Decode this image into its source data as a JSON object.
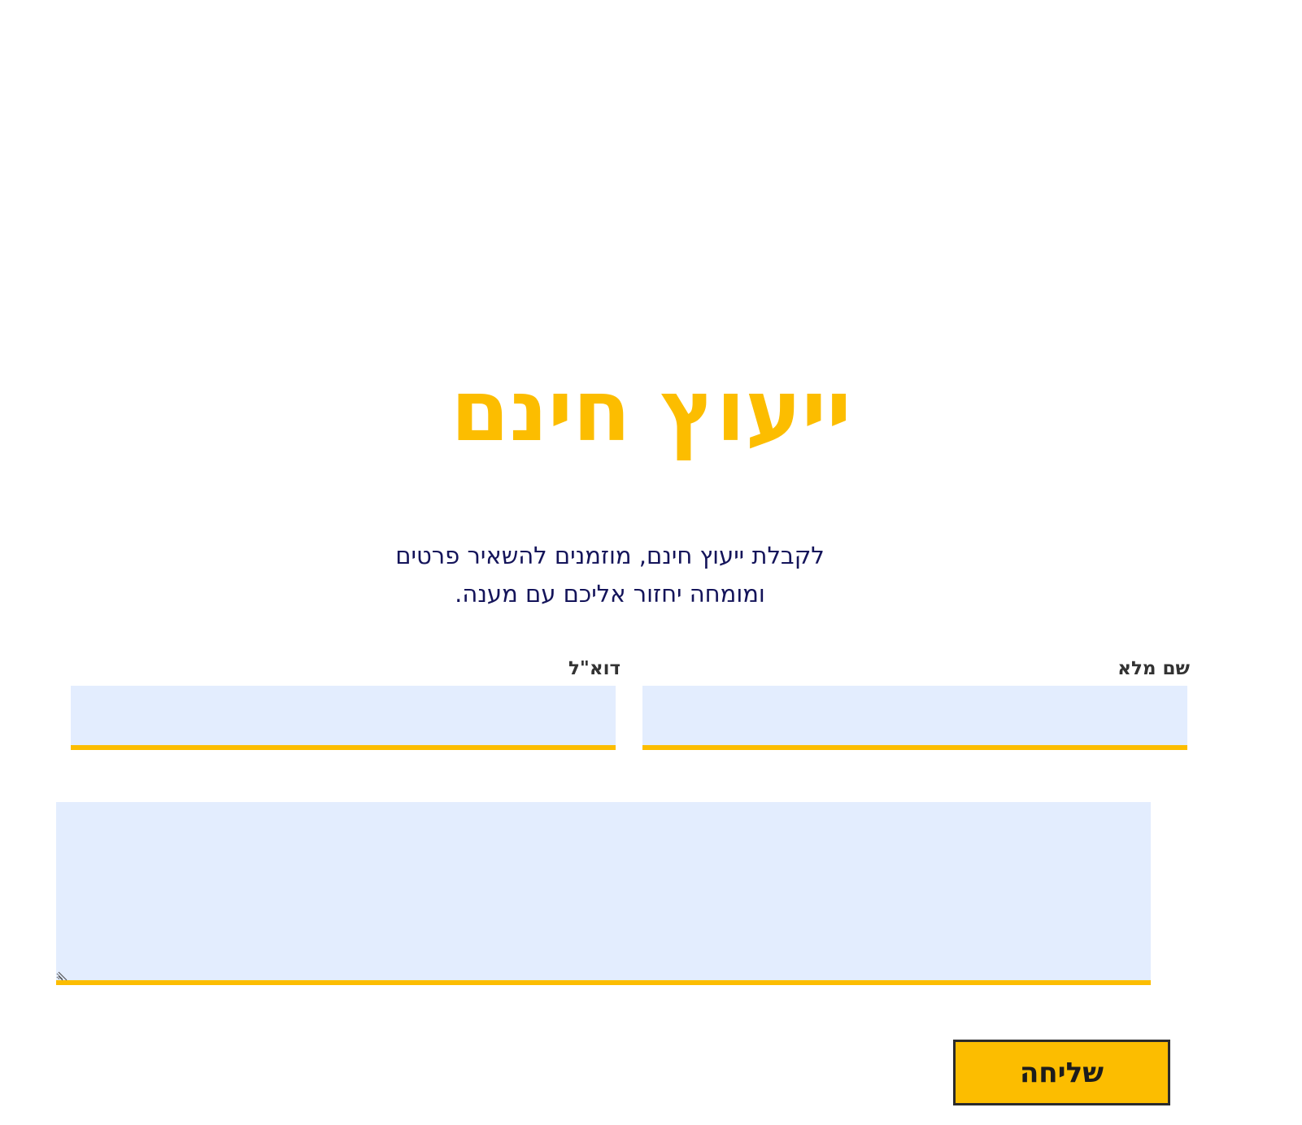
{
  "page": {
    "title": "ייעוץ חינם",
    "intro_line1": "לקבלת ייעוץ חינם, מוזמנים להשאיר פרטים",
    "intro_line2": "ומומחה יחזור אליכם עם מענה."
  },
  "form": {
    "name_label": "שם מלא",
    "name_value": "",
    "email_label": "דוא\"ל",
    "email_value": "",
    "message_value": "",
    "submit_label": "שליחה"
  },
  "colors": {
    "accent": "#fcbd00",
    "field_background": "#e3edfe",
    "intro_text": "#14145a",
    "label_text": "#333333"
  },
  "icons": {
    "resize": "resize-handle-icon"
  }
}
